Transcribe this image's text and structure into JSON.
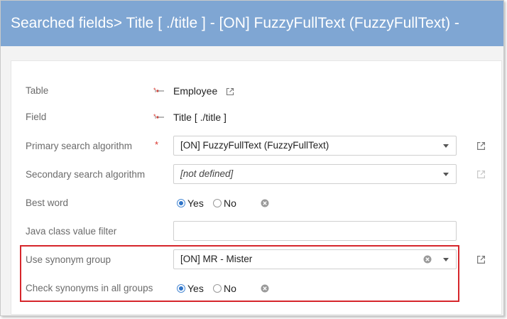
{
  "window": {
    "title": "Searched fields> Title [ ./title ] - [ON] FuzzyFullText (FuzzyFullText) -"
  },
  "form": {
    "table": {
      "label": "Table",
      "value": "Employee"
    },
    "field": {
      "label": "Field",
      "value": "Title [ ./title ]"
    },
    "primary": {
      "label": "Primary search algorithm",
      "required_mark": "*",
      "value": "[ON] FuzzyFullText (FuzzyFullText)"
    },
    "secondary": {
      "label": "Secondary search algorithm",
      "value": "[not defined]"
    },
    "best_word": {
      "label": "Best word",
      "yes": "Yes",
      "no": "No",
      "selected": "Yes"
    },
    "java_filter": {
      "label": "Java class value filter",
      "value": ""
    },
    "synonym_group": {
      "label": "Use synonym group",
      "value": "[ON] MR - Mister"
    },
    "check_all_groups": {
      "label": "Check synonyms in all groups",
      "yes": "Yes",
      "no": "No",
      "selected": "Yes"
    }
  },
  "colors": {
    "title_bar": "#7fa6d3",
    "highlight": "#d6262b",
    "radio_checked": "#2f74c8",
    "required": "#d9342b"
  },
  "icons": {
    "reference": "link-arrow-icon",
    "external": "external-link-icon",
    "clear": "clear-circle-icon",
    "dropdown": "caret-down-icon"
  }
}
